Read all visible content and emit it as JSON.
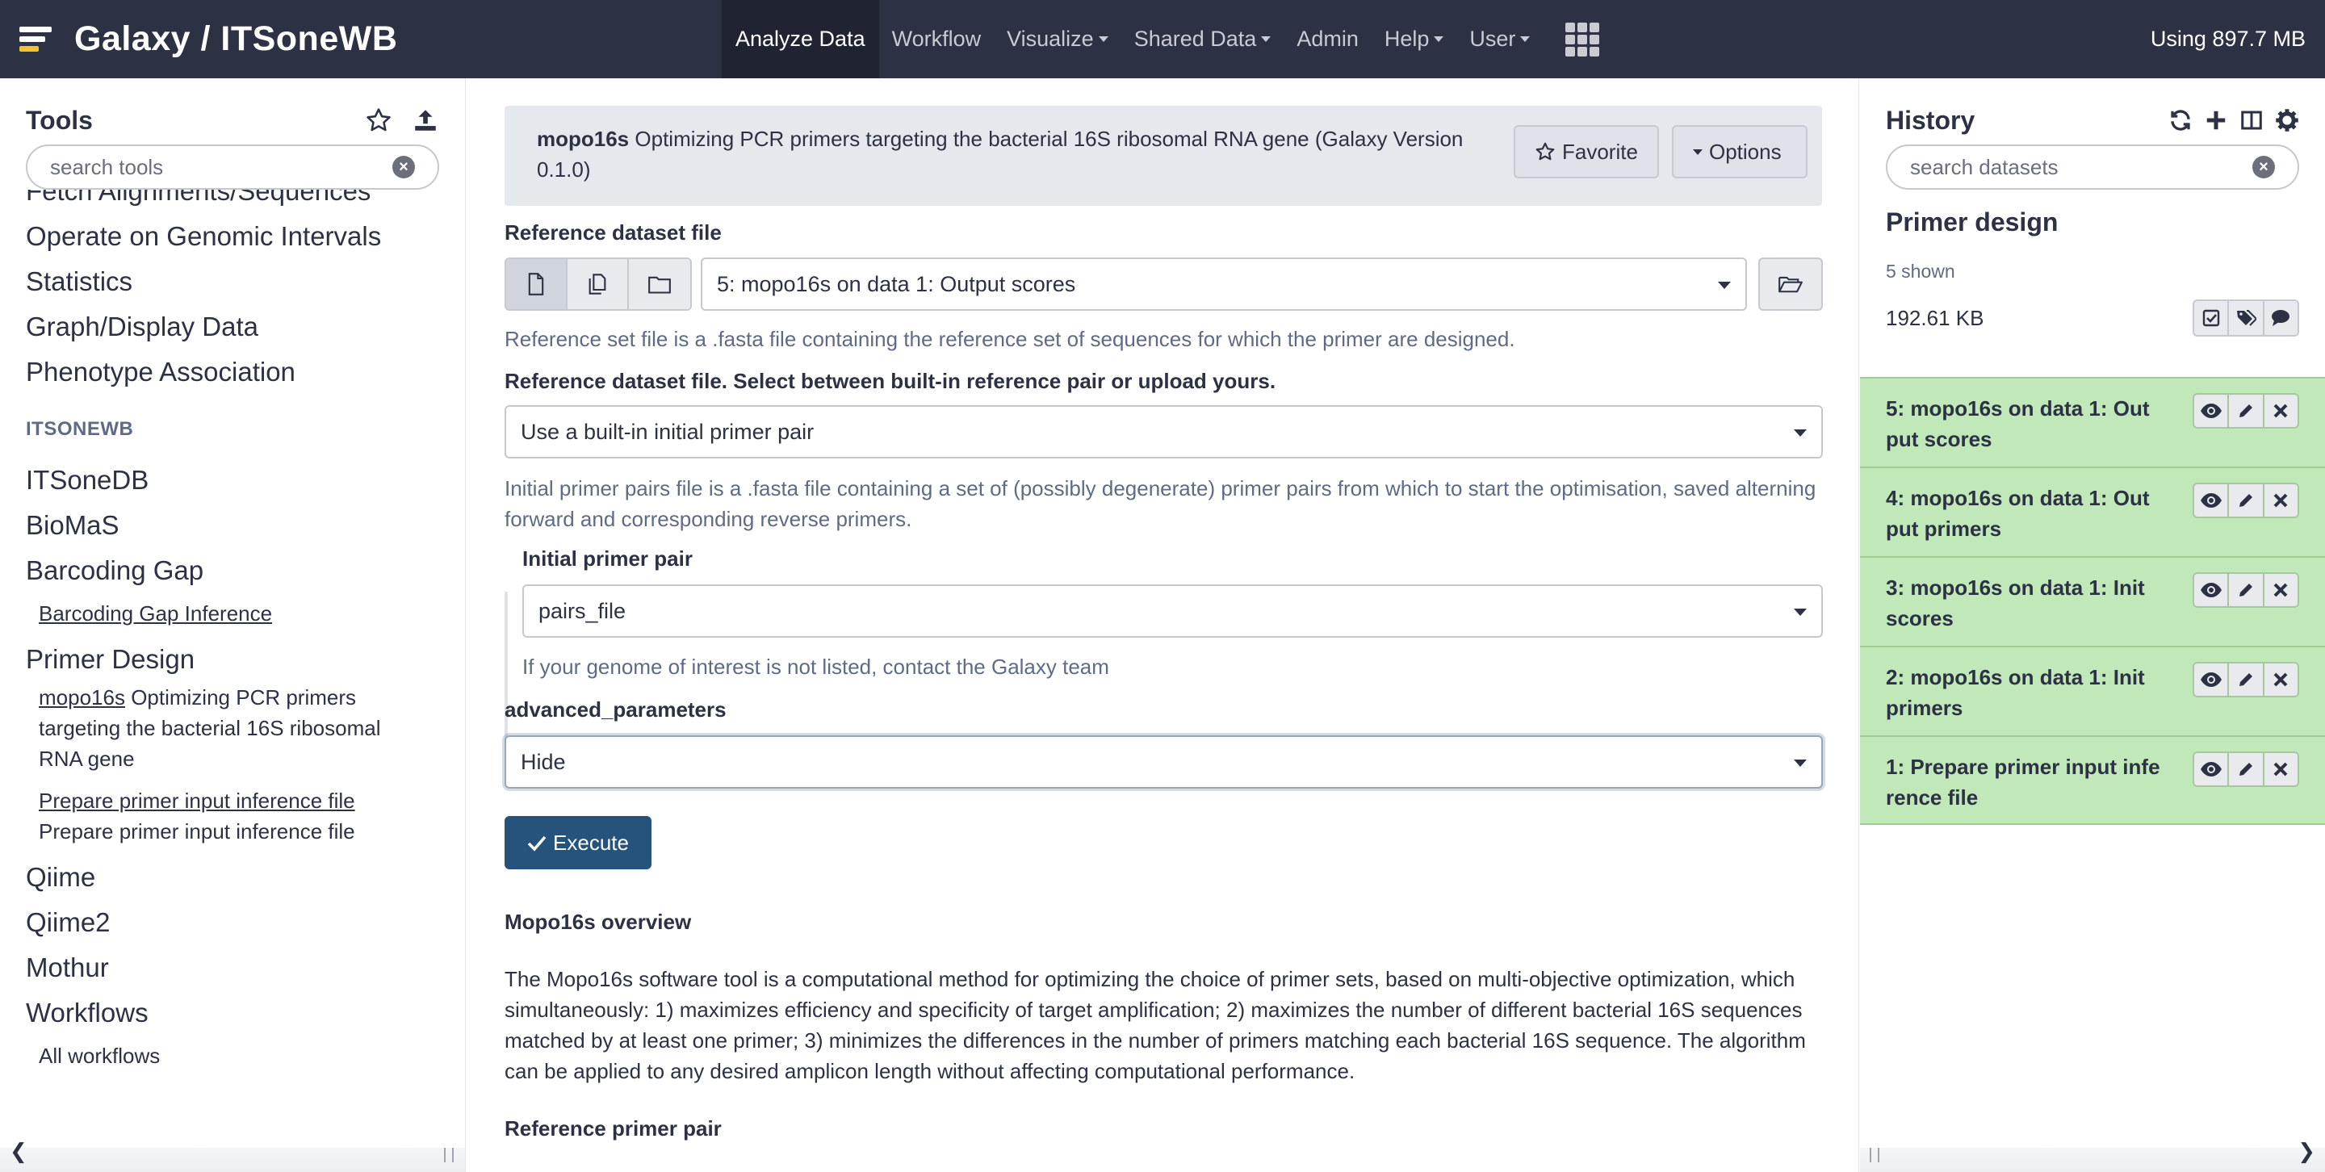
{
  "brand": {
    "title": "Galaxy / ITSoneWB"
  },
  "nav": {
    "items": [
      {
        "label": "Analyze Data"
      },
      {
        "label": "Workflow"
      },
      {
        "label": "Visualize"
      },
      {
        "label": "Shared Data"
      },
      {
        "label": "Admin"
      },
      {
        "label": "Help"
      },
      {
        "label": "User"
      }
    ],
    "usage": "Using 897.7 MB"
  },
  "tools_panel": {
    "title": "Tools",
    "search_placeholder": "search tools",
    "cut_item": "Fetch Alignments/Sequences",
    "sections_top": [
      "Operate on Genomic Intervals",
      "Statistics",
      "Graph/Display Data",
      "Phenotype Association"
    ],
    "label": "ITSONEWB",
    "sections_mid": [
      "ITSoneDB",
      "BioMaS",
      "Barcoding Gap"
    ],
    "barcoding_link": "Barcoding Gap Inference",
    "primer_section": "Primer Design",
    "mopo_link": "mopo16s",
    "mopo_desc": " Optimizing PCR primers targeting the bacterial 16S ribosomal RNA gene",
    "prepare_link": "Prepare primer input inference file",
    "prepare_desc": "Prepare primer input inference file",
    "sections_bottom": [
      "Qiime",
      "Qiime2",
      "Mothur",
      "Workflows"
    ],
    "workflows_link": "All workflows"
  },
  "tool_form": {
    "tool_name": "mopo16s",
    "tool_desc": " Optimizing PCR primers targeting the bacterial 16S ribosomal RNA gene (Galaxy Version 0.1.0)",
    "favorite_label": "Favorite",
    "options_label": "Options",
    "ref_label": "Reference dataset file",
    "ref_value": "5: mopo16s on data 1: Output scores",
    "ref_help": "Reference set file is a .fasta file containing the reference set of sequences for which the primer are designed.",
    "pair_label": "Reference dataset file. Select between built-in reference pair or upload yours.",
    "pair_value": "Use a built-in initial primer pair",
    "pair_help": "Initial primer pairs file is a .fasta file containing a set of (possibly degenerate) primer pairs from which to start the optimisation, saved alterning forward and corresponding reverse primers.",
    "initial_label": "Initial primer pair",
    "initial_value": "pairs_file",
    "initial_help": "If your genome of interest is not listed, contact the Galaxy team",
    "adv_label": "advanced_parameters",
    "adv_value": "Hide",
    "execute_label": "Execute",
    "overview_title": "Mopo16s overview",
    "overview_text": "The Mopo16s software tool is a computational method for optimizing the choice of primer sets, based on multi-objective optimization, which simultaneously: 1) maximizes efficiency and specificity of target amplification; 2) maximizes the number of different bacterial 16S sequences matched by at least one primer; 3) minimizes the differences in the number of primers matching each bacterial 16S sequence. The algorithm can be applied to any desired amplicon length without affecting computational performance.",
    "ref_pair_title": "Reference primer pair"
  },
  "history": {
    "title": "History",
    "search_placeholder": "search datasets",
    "name": "Primer design",
    "shown": "5 shown",
    "size": "192.61 KB",
    "datasets": [
      {
        "title": "5: mopo16s on data 1: Output scores"
      },
      {
        "title": "4: mopo16s on data 1: Output primers"
      },
      {
        "title": "3: mopo16s on data 1: Init scores"
      },
      {
        "title": "2: mopo16s on data 1: Init primers"
      },
      {
        "title": "1: Prepare primer input inference file"
      }
    ]
  },
  "colors": {
    "masthead": "#2c3143",
    "dataset_ok": "#c1e8b9",
    "primary_button": "#25537b"
  }
}
